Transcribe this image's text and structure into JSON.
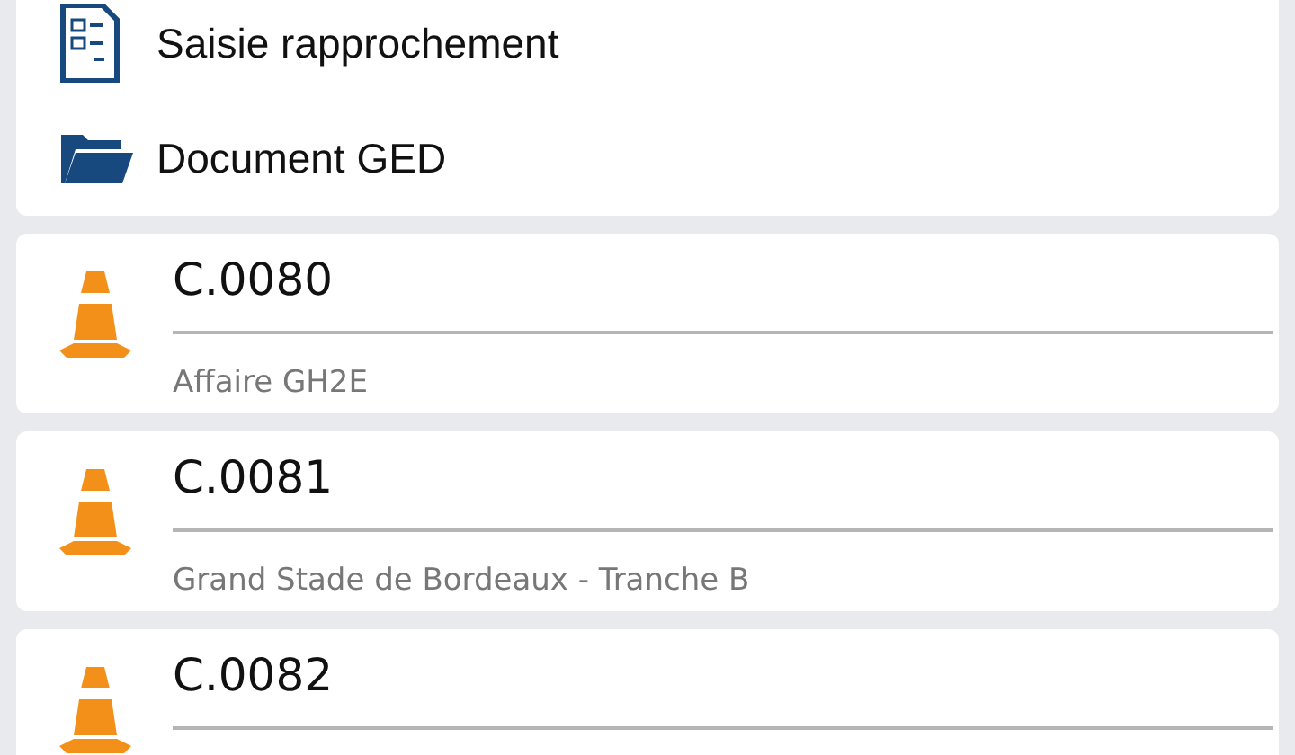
{
  "menu": [
    {
      "kind": "checklist",
      "label": "Saisie rapprochement"
    },
    {
      "kind": "folder",
      "label": "Document GED"
    }
  ],
  "projects": [
    {
      "code": "C.0080",
      "name": "Affaire GH2E"
    },
    {
      "code": "C.0081",
      "name": "Grand Stade de Bordeaux - Tranche B"
    },
    {
      "code": "C.0082"
    }
  ]
}
